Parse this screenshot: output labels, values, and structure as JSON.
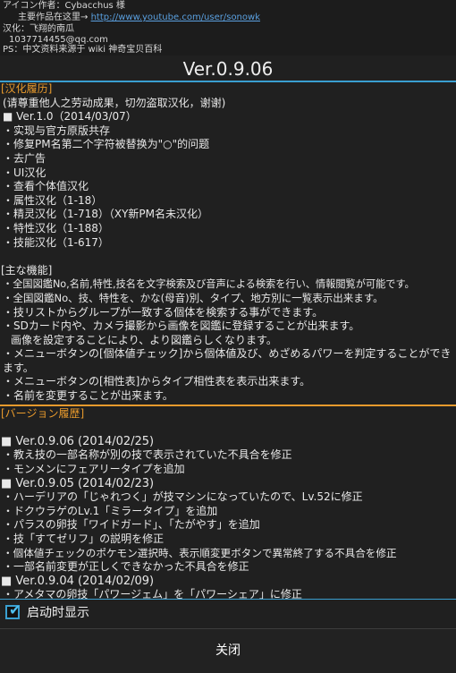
{
  "header": {
    "icon_author": "アイコン作者：Cybacchus 様",
    "main_works_prefix": "主要作品在这里→",
    "main_works_link": "http://www.youtube.com/user/sonowk",
    "translator": "汉化：飞翔的南瓜",
    "email": "1037714455@qq.com",
    "ps": "PS：中文资料来源于 wiki 神奇宝贝百科"
  },
  "title": "Ver.0.9.06",
  "sections": {
    "cn_history": {
      "title": "[汉化履历]",
      "notice": "(请尊重他人之劳动成果，切勿盗取汉化，谢谢)",
      "version": "■ Ver.1.0（2014/03/07）",
      "items": [
        "・实现与官方原版共存",
        "・修复PM名第二个字符被替换为\"○\"的问题",
        "・去广告",
        "・UI汉化",
        "・查看个体值汉化",
        "・属性汉化（1-18）",
        "・精灵汉化（1-718）（XY新PM名未汉化）",
        "・特性汉化（1-188）",
        "・技能汉化（1-617）"
      ]
    },
    "features": {
      "title": "[主な機能]",
      "items": [
        "・全国図鑑No,名前,特性,技名を文字検索及び音声による検索を行い、情報閲覧が可能です。",
        "・全国図鑑No、技、特性を、かな(母音)別、タイプ、地方別に一覧表示出来ます。",
        "・技リストからグループが一致する個体を検索する事ができます。",
        "・SDカード内や、カメラ撮影から画像を図鑑に登録することが出来ます。",
        "画像を設定することにより、より図鑑らしくなります。",
        "・メニューボタンの[個体値チェック]から個体値及び、めざめるパワーを判定することができます。",
        "・メニューボタンの[相性表]からタイプ相性表を表示出来ます。",
        "・名前を変更することが出来ます。"
      ]
    },
    "version_history": {
      "title": "[バージョン履歴]",
      "versions": [
        {
          "label": "■ Ver.0.9.06 (2014/02/25)",
          "items": [
            "・教え技の一部名称が別の技で表示されていた不具合を修正",
            "・モンメンにフェアリータイプを追加"
          ]
        },
        {
          "label": "■ Ver.0.9.05 (2014/02/23)",
          "items": [
            "・ハーデリアの「じゃれつく」が技マシンになっていたので、Lv.52に修正",
            "・ドクウラゲのLv.1「ミラータイプ」を追加",
            "・パラスの卵技「ワイドガード」、「たがやす」を追加",
            "・技「すてゼリフ」の説明を修正",
            "・個体値チェックのポケモン選択時、表示順変更ボタンで異常終了する不具合を修正",
            "・一部名前変更が正しくできなかった不具合を修正"
          ]
        },
        {
          "label": "■ Ver.0.9.04 (2014/02/09)",
          "items": [
            "・アメタマの卵技「パワージェム」を「パワーシェア」に修正"
          ]
        }
      ]
    }
  },
  "footer": {
    "checkbox_label": "启动时显示",
    "checkbox_checked": true,
    "close_label": "关闭"
  },
  "colors": {
    "accent_blue": "#3a9fd0",
    "section_orange": "#e89a2c",
    "background": "#202020"
  }
}
